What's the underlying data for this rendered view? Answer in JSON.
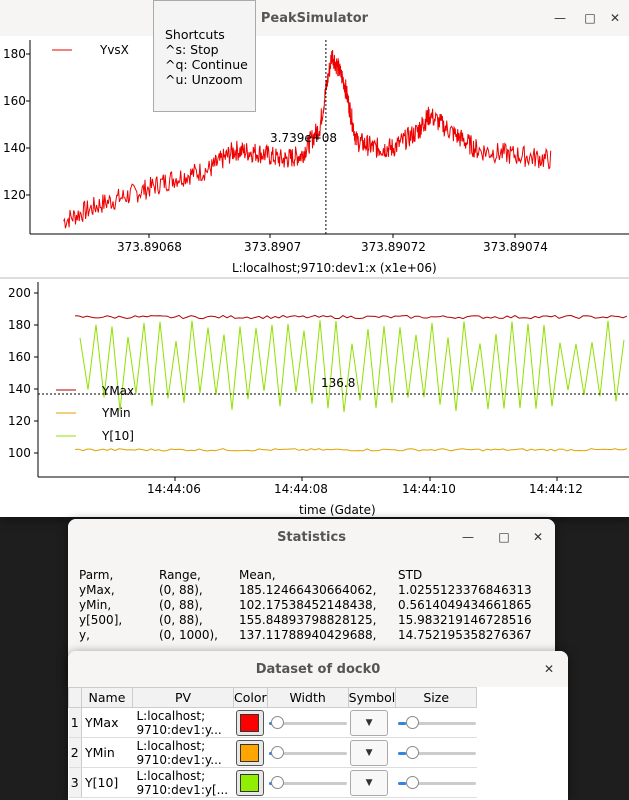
{
  "main_window": {
    "title": "PeakSimulator",
    "minimize_icon": "minimize-icon",
    "maximize_icon": "maximize-icon",
    "close_icon": "close-icon"
  },
  "shortcuts": {
    "title": "Shortcuts",
    "items": [
      "^s: Stop",
      "^q: Continue",
      "^u: Unzoom"
    ]
  },
  "top_plot": {
    "legend": "YvsX",
    "cursor_label": "3.739e+08",
    "xlabel": "L:localhost;9710:dev1:x (x1e+06)",
    "colors": {
      "series": "#ee0000"
    }
  },
  "bottom_plot": {
    "legend": [
      "YMax",
      "YMin",
      "Y[10]"
    ],
    "marker_label": "136.8",
    "xlabel": "time (Gdate)",
    "colors": {
      "ymax": "#b00000",
      "ymin": "#e0a000",
      "y10": "#90e000"
    }
  },
  "chart_data": [
    {
      "type": "line",
      "title": "",
      "xlabel": "L:localhost;9710:dev1:x (x1e+06)",
      "ylabel": "",
      "x_ticks": [
        "373.89068",
        "373.8907",
        "373.89072",
        "373.89074"
      ],
      "y_ticks": [
        "120",
        "140",
        "160",
        "180"
      ],
      "ylim": [
        105,
        186
      ],
      "cursor_x": 373.890709,
      "series": [
        {
          "name": "YvsX",
          "x": [
            373.890666,
            373.890672,
            373.890678,
            373.890684,
            373.89069,
            373.890694,
            373.890698,
            373.890702,
            373.890705,
            373.890708,
            373.89071,
            373.890712,
            373.890714,
            373.890717,
            373.89072,
            373.890724,
            373.890726,
            373.89073,
            373.890734,
            373.89074,
            373.890746
          ],
          "y": [
            109,
            116,
            121,
            127,
            131,
            139,
            138,
            135,
            137,
            149,
            180,
            168,
            143,
            140,
            140,
            147,
            154,
            146,
            139,
            137,
            135
          ]
        }
      ]
    },
    {
      "type": "line",
      "title": "",
      "xlabel": "time (Gdate)",
      "ylabel": "",
      "x_ticks": [
        "14:44:06",
        "14:44:08",
        "14:44:10",
        "14:44:12"
      ],
      "y_ticks": [
        "100",
        "120",
        "140",
        "160",
        "180",
        "200"
      ],
      "ylim": [
        85,
        205
      ],
      "marker_y": 136.8,
      "series": [
        {
          "name": "YMax",
          "y_level": 185
        },
        {
          "name": "YMin",
          "y_level": 102
        },
        {
          "name": "Y[10]",
          "y_min": 125,
          "y_max": 183
        }
      ]
    }
  ],
  "statistics": {
    "title": "Statistics",
    "headers": [
      "Parm,",
      "Range,",
      "Mean,",
      "STD"
    ],
    "rows": [
      [
        "yMax,",
        "(0, 88),",
        "185.12466430664062,",
        "1.0255123376846313"
      ],
      [
        "yMin,",
        "(0, 88),",
        "102.17538452148438,",
        "0.5614049434661865"
      ],
      [
        "y[500],",
        "(0, 88),",
        "155.84893798828125,",
        "15.983219146728516"
      ],
      [
        "y,",
        "(0, 1000),",
        "137.11788940429688,",
        "14.752195358276367"
      ]
    ]
  },
  "dataset": {
    "title": "Dataset of dock0",
    "headers": [
      "Name",
      "PV",
      "Color",
      "Width",
      "Symbol",
      "Size"
    ],
    "rows": [
      {
        "num": "1",
        "name": "YMax",
        "pv1": "L:localhost;",
        "pv2": "9710:dev1:y...",
        "color": "#ff0000"
      },
      {
        "num": "2",
        "name": "YMin",
        "pv1": "L:localhost;",
        "pv2": "9710:dev1:y...",
        "color": "#ffa500"
      },
      {
        "num": "3",
        "name": "Y[10]",
        "pv1": "L:localhost;",
        "pv2": "9710:dev1:y[...",
        "color": "#90ee00"
      }
    ]
  }
}
